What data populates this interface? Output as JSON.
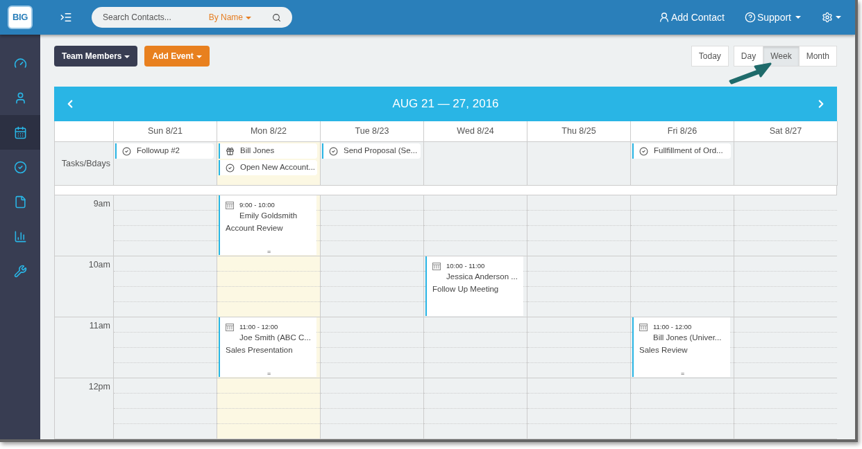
{
  "logo": {
    "text": "BIG"
  },
  "search": {
    "placeholder": "Search Contacts...",
    "filter": "By Name"
  },
  "nav": {
    "add_contact": "Add Contact",
    "support": "Support"
  },
  "sidebar": {
    "items": [
      {
        "selected": false
      },
      {
        "selected": false
      },
      {
        "selected": true
      },
      {
        "selected": false
      },
      {
        "selected": false
      },
      {
        "selected": false
      },
      {
        "selected": false
      }
    ]
  },
  "toolbar": {
    "team_members": "Team Members",
    "add_event": "Add Event",
    "today": "Today",
    "views": [
      {
        "label": "Day",
        "selected": false
      },
      {
        "label": "Week",
        "selected": true
      },
      {
        "label": "Month",
        "selected": false
      }
    ]
  },
  "calendar": {
    "title": "AUG 21 — 27, 2016",
    "tasks_label": "Tasks/Bdays",
    "days": [
      {
        "label": "Sun 8/21",
        "today": false,
        "tasks": [
          {
            "kind": "task",
            "text": "Followup #2"
          }
        ]
      },
      {
        "label": "Mon 8/22",
        "today": true,
        "tasks": [
          {
            "kind": "birthday",
            "text": "Bill Jones"
          },
          {
            "kind": "task",
            "text": "Open New Account..."
          }
        ]
      },
      {
        "label": "Tue 8/23",
        "today": false,
        "tasks": [
          {
            "kind": "task",
            "text": "Send Proposal (Se..."
          }
        ]
      },
      {
        "label": "Wed 8/24",
        "today": false
      },
      {
        "label": "Thu 8/25",
        "today": false
      },
      {
        "label": "Fri 8/26",
        "today": false,
        "tasks": [
          {
            "kind": "task",
            "text": "Fullfillment of Ord..."
          }
        ]
      },
      {
        "label": "Sat 8/27",
        "today": false
      }
    ],
    "hours": [
      {
        "time": "9am",
        "cells": [
          null,
          {
            "time": "9:00 - 10:00",
            "contact": "Emily Goldsmith",
            "title": "Account Review",
            "handle": "="
          },
          null,
          null,
          null,
          null,
          null
        ]
      },
      {
        "time": "10am",
        "cells": [
          null,
          null,
          null,
          {
            "time": "10:00 - 11:00",
            "contact": "Jessica Anderson ...",
            "title": "Follow Up Meeting"
          },
          null,
          null,
          null
        ]
      },
      {
        "time": "11am",
        "cells": [
          null,
          {
            "time": "11:00 - 12:00",
            "contact": "Joe Smith (ABC C...",
            "title": "Sales Presentation",
            "handle": "="
          },
          null,
          null,
          null,
          {
            "time": "11:00 - 12:00",
            "contact": "Bill Jones (Univer...",
            "title": "Sales Review",
            "handle": "="
          },
          null
        ]
      },
      {
        "time": "12pm",
        "cells": [
          null,
          null,
          null,
          null,
          null,
          null,
          null
        ]
      }
    ]
  }
}
